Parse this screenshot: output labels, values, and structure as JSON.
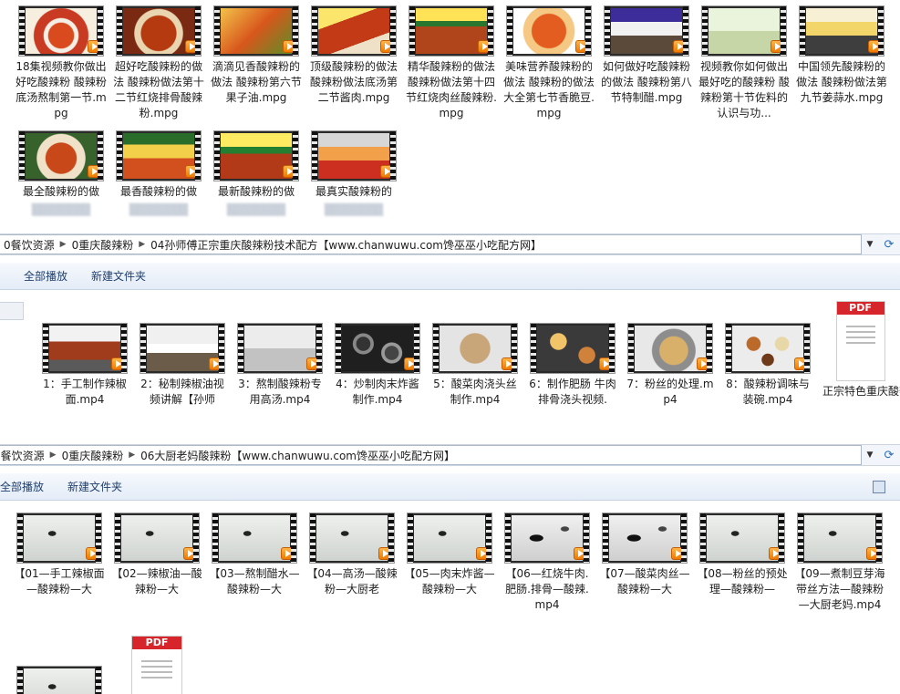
{
  "section1": {
    "items": [
      {
        "label": "18集视频教你做出好吃酸辣粉 酸辣粉底汤熬制第一节.mpg",
        "thumb": "food1"
      },
      {
        "label": "超好吃酸辣粉的做法 酸辣粉做法第十二节红烧排骨酸辣粉.mpg",
        "thumb": "food2"
      },
      {
        "label": "滴滴见香酸辣粉的做法 酸辣粉第六节果子油.mpg",
        "thumb": "food3"
      },
      {
        "label": "顶级酸辣粉的做法 酸辣粉做法底汤第二节酱肉.mpg",
        "thumb": "food4"
      },
      {
        "label": "精华酸辣粉的做法 酸辣粉做法第十四节红烧肉丝酸辣粉.mpg",
        "thumb": "food5"
      },
      {
        "label": "美味营养酸辣粉的做法 酸辣粉的做法大全第七节香脆豆.mpg",
        "thumb": "food6"
      },
      {
        "label": "如何做好吃酸辣粉的做法 酸辣粉第八节特制醋.mpg",
        "thumb": "food7"
      },
      {
        "label": "视频教你如何做出最好吃的酸辣粉 酸辣粉第十节佐料的认识与功...",
        "thumb": "food8"
      },
      {
        "label": "中国领先酸辣粉的做法 酸辣粉做法第九节姜蒜水.mpg",
        "thumb": "food9"
      },
      {
        "label": "最全酸辣粉的做",
        "thumb": "food10"
      },
      {
        "label": "最香酸辣粉的做",
        "thumb": "food11"
      },
      {
        "label": "最新酸辣粉的做",
        "thumb": "food12"
      },
      {
        "label": "最真实酸辣粉的",
        "thumb": "food13"
      }
    ]
  },
  "address1": {
    "crumbs": [
      "0餐饮资源",
      "0重庆酸辣粉",
      "04孙师傅正宗重庆酸辣粉技术配方【www.chanwuwu.com馋巫巫小吃配方网】"
    ]
  },
  "toolbar1": {
    "play_all": "全部播放",
    "new_folder": "新建文件夹"
  },
  "section2": {
    "items": [
      {
        "label": "1：手工制作辣椒面.mp4",
        "thumb": "kit1"
      },
      {
        "label": "2：秘制辣椒油视频讲解【孙师",
        "thumb": "kit2"
      },
      {
        "label": "3：熬制酸辣粉专用高汤.mp4",
        "thumb": "kit3"
      },
      {
        "label": "4：炒制肉末炸酱制作.mp4",
        "thumb": "kit4"
      },
      {
        "label": "5：酸菜肉浇头丝制作.mp4",
        "thumb": "kit5"
      },
      {
        "label": "6：制作肥肠 牛肉 排骨浇头视频.",
        "thumb": "kit6"
      },
      {
        "label": "7：粉丝的处理.mp4",
        "thumb": "kit7"
      },
      {
        "label": "8：酸辣粉调味与装碗.mp4",
        "thumb": "kit8"
      }
    ],
    "pdf": {
      "badge": "PDF",
      "label": "正宗特色重庆酸辣粉配方资料比"
    }
  },
  "address2": {
    "crumbs": [
      "0餐饮资源",
      "0重庆酸辣粉",
      "06大厨老妈酸辣粉【www.chanwuwu.com馋巫巫小吃配方网】"
    ]
  },
  "toolbar2": {
    "play_all": "全部播放",
    "new_folder": "新建文件夹"
  },
  "section3": {
    "items": [
      {
        "label": "【01—手工辣椒面—酸辣粉—大",
        "thumb": "ink"
      },
      {
        "label": "【02—辣椒油—酸辣粉—大",
        "thumb": "ink"
      },
      {
        "label": "【03—熬制醋水—酸辣粉—大",
        "thumb": "ink"
      },
      {
        "label": "【04—高汤—酸辣粉—大厨老",
        "thumb": "ink"
      },
      {
        "label": "【05—肉末炸酱—酸辣粉—大",
        "thumb": "ink"
      },
      {
        "label": "【06—红烧牛肉.肥肠.排骨—酸辣.mp4",
        "thumb": "ink2"
      },
      {
        "label": "【07—酸菜肉丝—酸辣粉—大",
        "thumb": "ink2"
      },
      {
        "label": "【08—粉丝的预处理—酸辣粉—",
        "thumb": "ink"
      },
      {
        "label": "【09—煮制豆芽海带丝方法—酸辣粉—大厨老妈.mp4",
        "thumb": "ink"
      },
      {
        "label": "",
        "thumb": "ink"
      }
    ],
    "pdf": {
      "badge": "PDF"
    }
  }
}
